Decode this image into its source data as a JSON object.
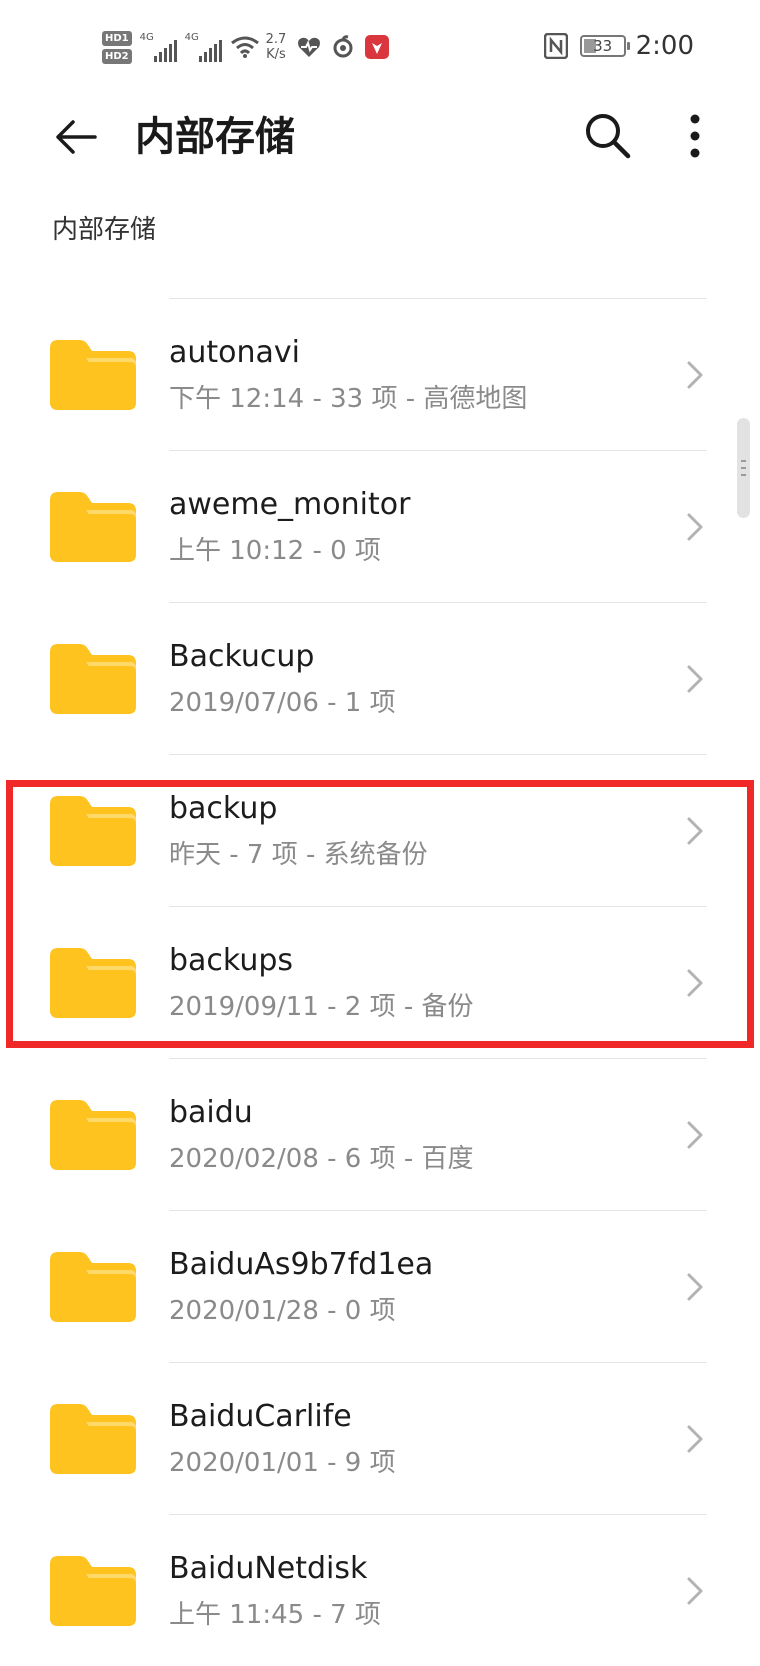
{
  "status_bar": {
    "hd1": "HD1",
    "hd2": "HD2",
    "sig1_label": "4G",
    "sig2_label": "4G",
    "speed_value": "2.7",
    "speed_unit": "K/s",
    "battery": "33",
    "time": "2:00",
    "icons": [
      "wifi-icon",
      "heart-health-icon",
      "netease-music-icon",
      "huawei-app-icon",
      "nfc-icon",
      "battery-icon"
    ]
  },
  "app_bar": {
    "title": "内部存储",
    "back_icon": "arrow-left-icon",
    "search_icon": "search-icon",
    "more_icon": "more-vertical-icon"
  },
  "breadcrumb": "内部存储",
  "folders": [
    {
      "name": "autonavi",
      "meta": "下午 12:14 - 33 项 - 高德地图"
    },
    {
      "name": "aweme_monitor",
      "meta": "上午 10:12 - 0 项"
    },
    {
      "name": "Backucup",
      "meta": "2019/07/06 - 1 项"
    },
    {
      "name": "backup",
      "meta": "昨天 - 7 项 - 系统备份"
    },
    {
      "name": "backups",
      "meta": "2019/09/11 - 2 项 - 备份"
    },
    {
      "name": "baidu",
      "meta": "2020/02/08 - 6 项 - 百度"
    },
    {
      "name": "BaiduAs9b7fd1ea",
      "meta": "2020/01/28 - 0 项"
    },
    {
      "name": "BaiduCarlife",
      "meta": "2020/01/01 - 9 项"
    },
    {
      "name": "BaiduNetdisk",
      "meta": "上午 11:45 - 7 项"
    }
  ],
  "colors": {
    "folder": "#FFC31F",
    "folder_tab": "#FFD96A",
    "highlight": "#F02828"
  }
}
